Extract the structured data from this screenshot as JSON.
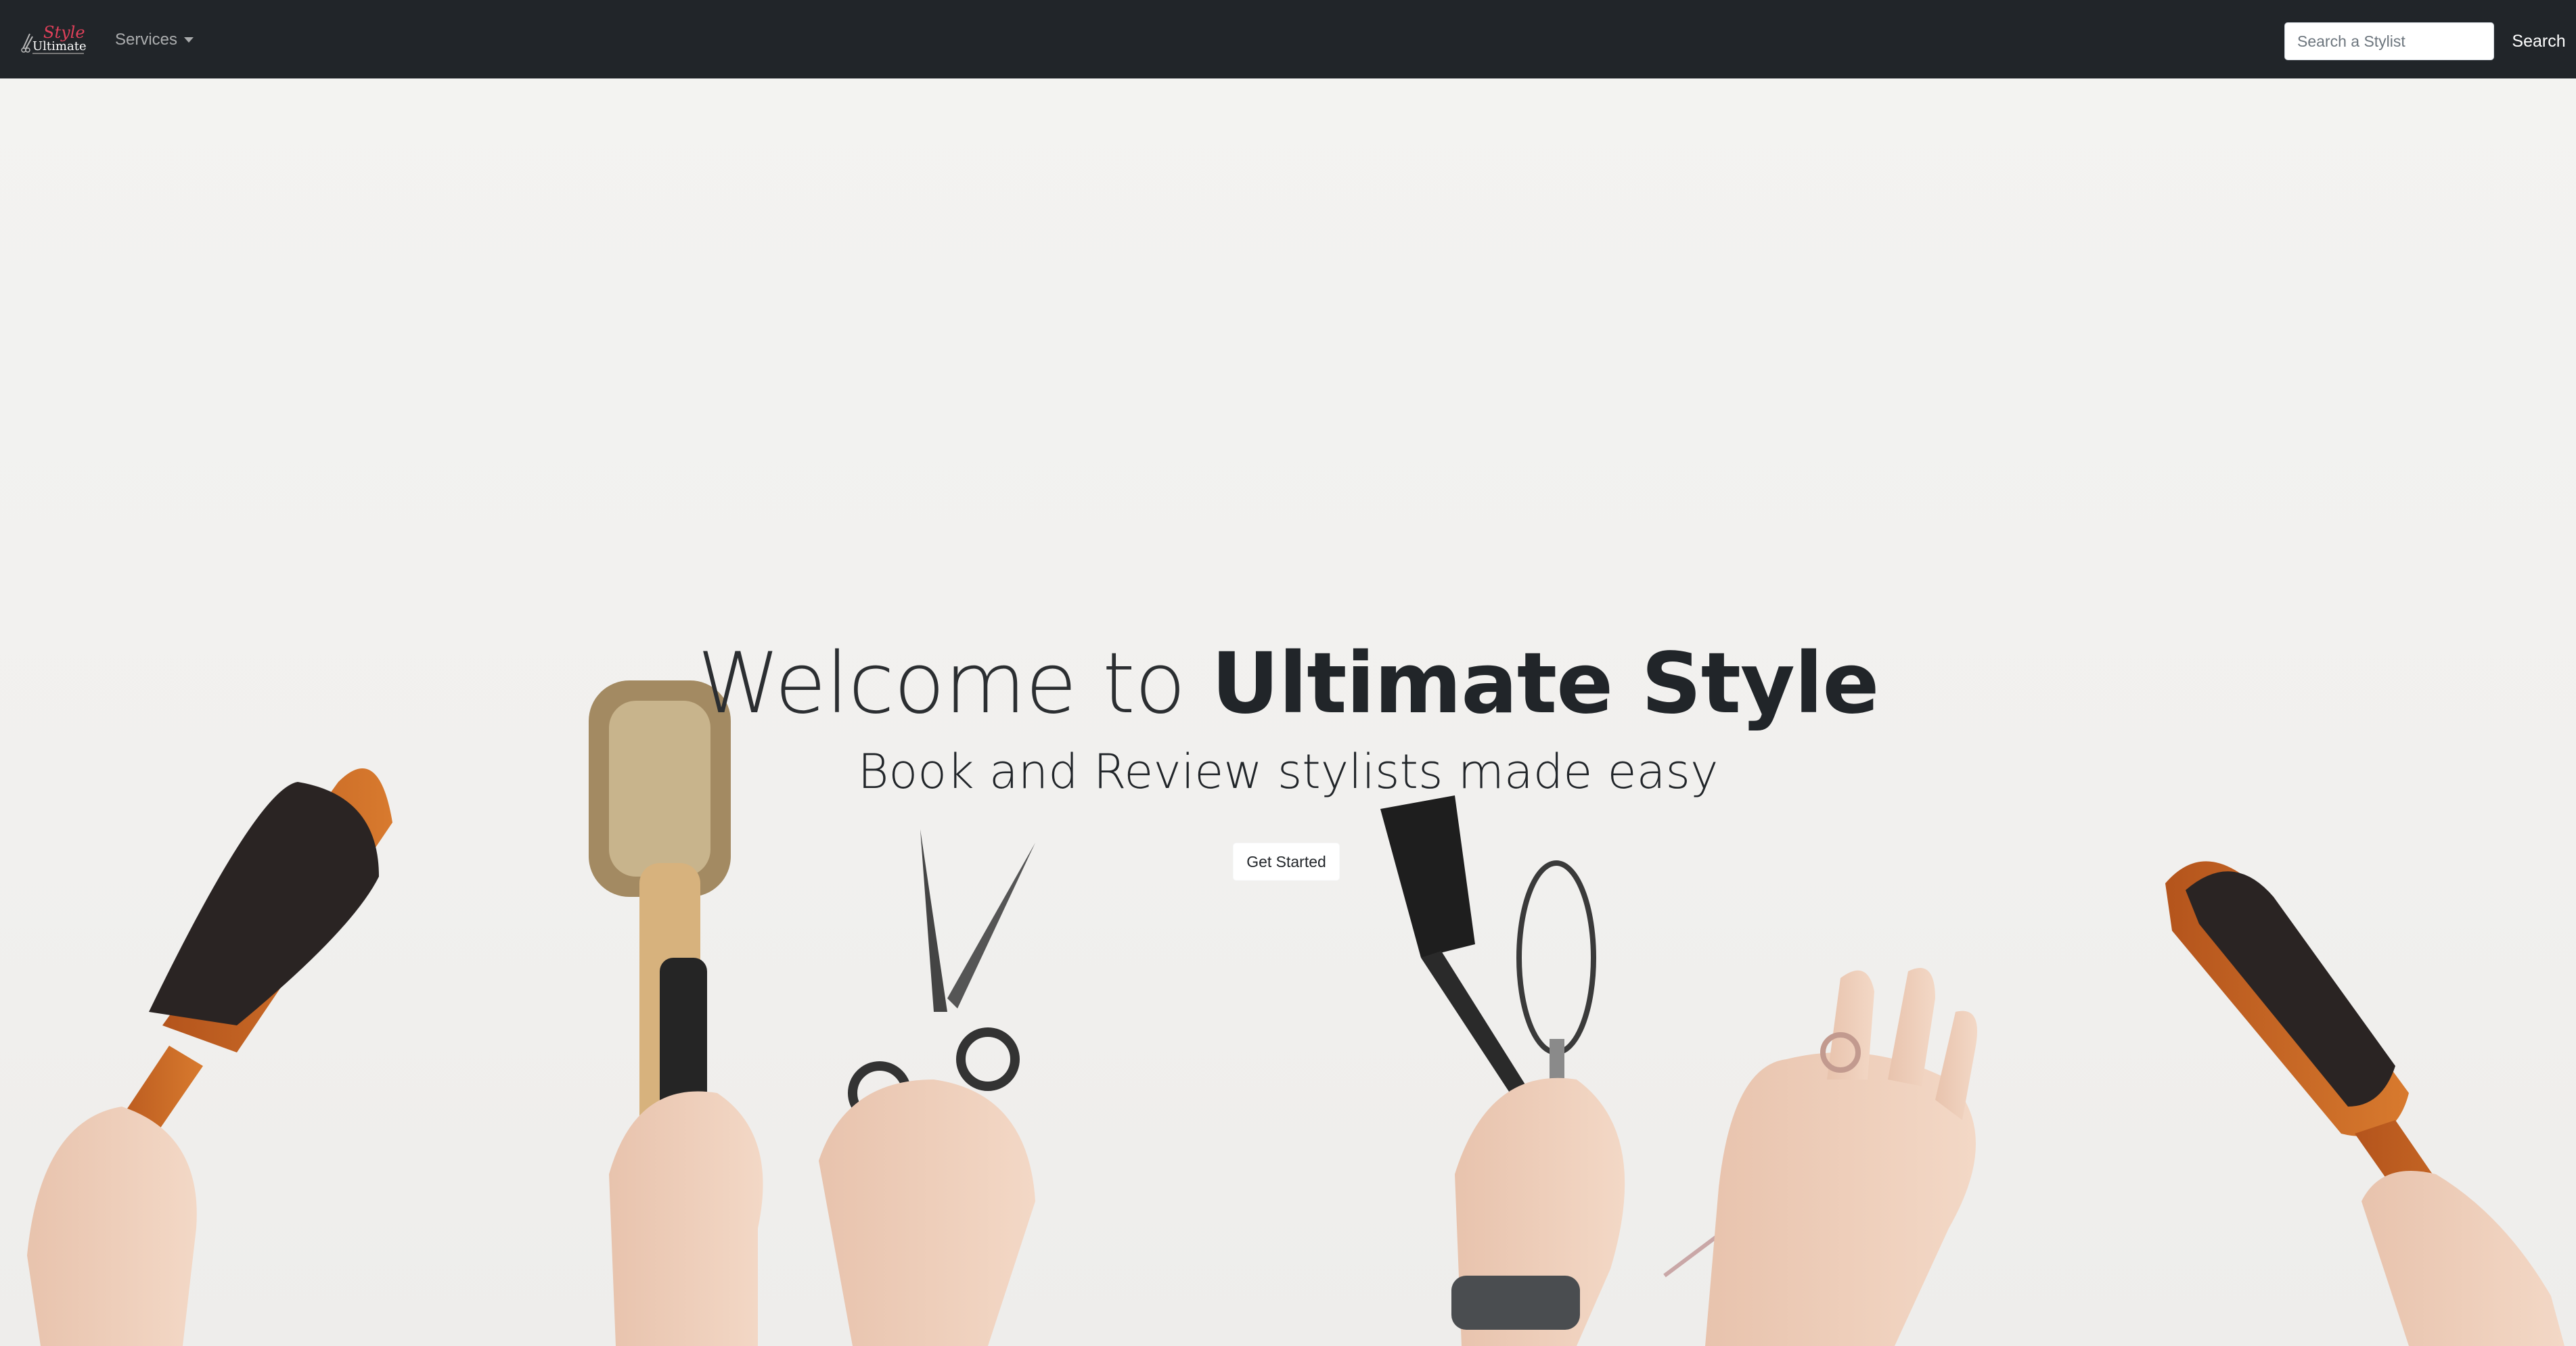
{
  "navbar": {
    "brand": {
      "logo_word": "Ultimate",
      "logo_script": "Style",
      "icon": "scissors-logo-icon"
    },
    "services_label": "Services",
    "search": {
      "placeholder": "Search a Stylist",
      "value": "",
      "button_label": "Search"
    }
  },
  "hero": {
    "headline_prefix": "Welcome to",
    "headline_brand": "Ultimate Style",
    "subheadline": "Book and Review stylists made easy",
    "cta_label": "Get Started",
    "background_image": "hands-holding-hair-tools-photo"
  },
  "colors": {
    "navbar_bg": "#212529",
    "hero_bg": "#f2f1ef",
    "text_dark": "#212529",
    "logo_accent": "#e0405a"
  }
}
